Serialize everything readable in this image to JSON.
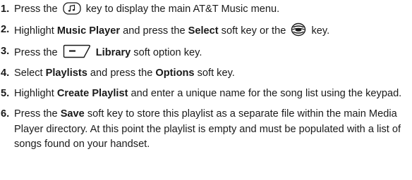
{
  "steps": [
    {
      "number": "1.",
      "parts": [
        {
          "t": "text",
          "v": "Press the "
        },
        {
          "t": "icon",
          "name": "music-key-icon"
        },
        {
          "t": "text",
          "v": " key to display the main AT&T Music menu."
        }
      ]
    },
    {
      "number": "2.",
      "parts": [
        {
          "t": "text",
          "v": "Highlight "
        },
        {
          "t": "bold",
          "v": "Music Player"
        },
        {
          "t": "text",
          "v": " and press the "
        },
        {
          "t": "bold",
          "v": "Select"
        },
        {
          "t": "text",
          "v": " soft key or the "
        },
        {
          "t": "icon",
          "name": "nav-select-key-icon"
        },
        {
          "t": "text",
          "v": " key."
        }
      ]
    },
    {
      "number": "3.",
      "parts": [
        {
          "t": "text",
          "v": "Press the "
        },
        {
          "t": "icon",
          "name": "left-soft-key-icon"
        },
        {
          "t": "text",
          "v": " "
        },
        {
          "t": "bold",
          "v": "Library"
        },
        {
          "t": "text",
          "v": " soft option key."
        }
      ]
    },
    {
      "number": "4.",
      "parts": [
        {
          "t": "text",
          "v": "Select "
        },
        {
          "t": "bold",
          "v": "Playlists"
        },
        {
          "t": "text",
          "v": " and press the "
        },
        {
          "t": "bold",
          "v": "Options"
        },
        {
          "t": "text",
          "v": " soft key."
        }
      ]
    },
    {
      "number": "5.",
      "parts": [
        {
          "t": "text",
          "v": "Highlight "
        },
        {
          "t": "bold",
          "v": "Create Playlist"
        },
        {
          "t": "text",
          "v": " and enter a unique name for the song list using the keypad."
        }
      ]
    },
    {
      "number": "6.",
      "parts": [
        {
          "t": "text",
          "v": "Press the "
        },
        {
          "t": "bold",
          "v": "Save"
        },
        {
          "t": "text",
          "v": " soft key to store this playlist as a separate file within the main Media Player directory. At this point the playlist is empty and must be populated with a list of songs found on your handset."
        }
      ]
    }
  ]
}
